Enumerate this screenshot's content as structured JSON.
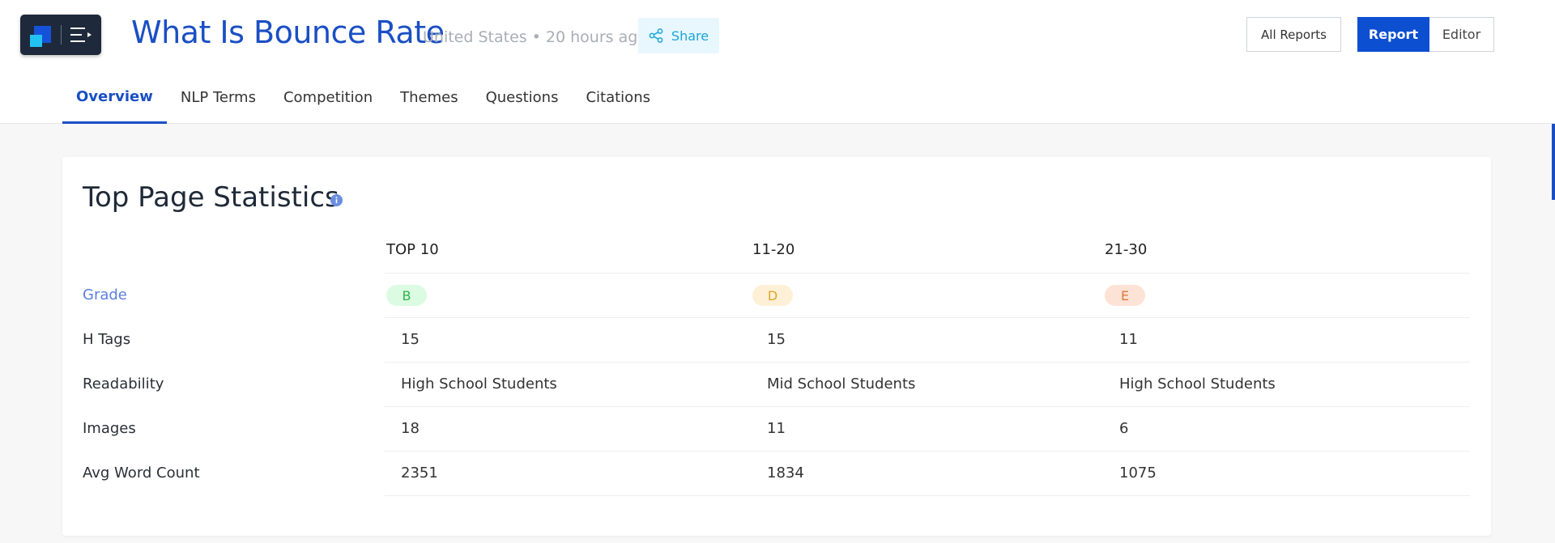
{
  "header": {
    "title": "What Is Bounce Rate",
    "location": "United States",
    "separator": "•",
    "updated": "20 hours ago",
    "share_label": "Share",
    "all_reports_label": "All Reports",
    "report_label": "Report",
    "editor_label": "Editor"
  },
  "tabs": [
    {
      "label": "Overview",
      "active": true
    },
    {
      "label": "NLP Terms",
      "active": false
    },
    {
      "label": "Competition",
      "active": false
    },
    {
      "label": "Themes",
      "active": false
    },
    {
      "label": "Questions",
      "active": false
    },
    {
      "label": "Citations",
      "active": false
    }
  ],
  "stats": {
    "title": "Top Page Statistics",
    "columns": [
      "TOP 10",
      "11-20",
      "21-30"
    ],
    "grade_label": "Grade",
    "grades": [
      "B",
      "D",
      "E"
    ],
    "rows": [
      {
        "label": "H Tags",
        "values": [
          "15",
          "15",
          "11"
        ]
      },
      {
        "label": "Readability",
        "values": [
          "High School Students",
          "Mid School Students",
          "High School Students"
        ]
      },
      {
        "label": "Images",
        "values": [
          "18",
          "11",
          "6"
        ]
      },
      {
        "label": "Avg Word Count",
        "values": [
          "2351",
          "1834",
          "1075"
        ]
      }
    ]
  },
  "colors": {
    "brand_blue": "#1a4fc4",
    "report_button": "#0d4fd1",
    "share_text": "#1aa6d8",
    "grade_b": "#2fb44b",
    "grade_d": "#e0a530",
    "grade_e": "#e57737"
  }
}
